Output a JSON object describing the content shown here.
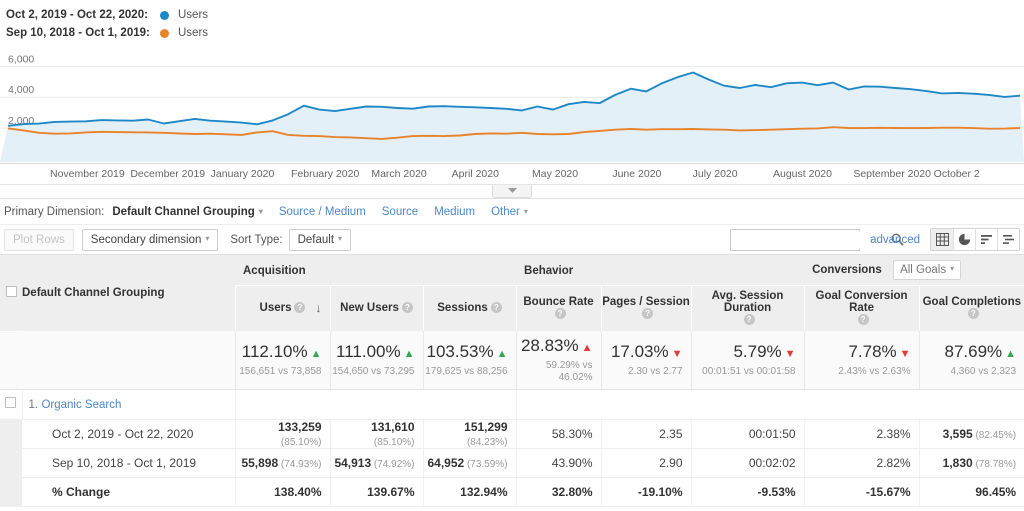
{
  "legend": {
    "rows": [
      {
        "label": "Oct 2, 2019 - Oct 22, 2020:",
        "series": "Users",
        "color": "#1E88C7"
      },
      {
        "label": "Sep 10, 2018 - Oct 1, 2019:",
        "series": "Users",
        "color": "#E8832A"
      }
    ]
  },
  "chart_data": {
    "type": "line",
    "title": "",
    "xlabel": "",
    "ylabel": "Users",
    "ylim": [
      0,
      6800
    ],
    "yticks": [
      "6,000",
      "4,000",
      "2,000"
    ],
    "ytick_values": [
      6000,
      4000,
      2000
    ],
    "grid": true,
    "legend_position": "top-left",
    "categories": [
      "November 2019",
      "December 2019",
      "January 2020",
      "February 2020",
      "March 2020",
      "April 2020",
      "May 2020",
      "June 2020",
      "July 2020",
      "August 2020",
      "September 2020",
      "October 2"
    ],
    "series": [
      {
        "name": "Users",
        "period": "Oct 2, 2019 - Oct 22, 2020",
        "color": "#1E88C7",
        "values": [
          2150,
          2260,
          2290,
          2400,
          2420,
          2440,
          2520,
          2500,
          2480,
          2560,
          2300,
          2450,
          2600,
          2480,
          2420,
          2360,
          2250,
          2500,
          2900,
          3450,
          3200,
          3100,
          3250,
          3400,
          3380,
          3300,
          3260,
          3400,
          3420,
          3380,
          3350,
          3300,
          3250,
          3150,
          3400,
          3200,
          3550,
          3700,
          3620,
          4150,
          4550,
          4380,
          4900,
          5300,
          5600,
          5150,
          4750,
          4600,
          4800,
          4650,
          4900,
          4950,
          4780,
          4950,
          4500,
          4700,
          4680,
          4600,
          4520,
          4400,
          4250,
          4280,
          4230,
          4150,
          4020,
          4100
        ]
      },
      {
        "name": "Users",
        "period": "Sep 10, 2018 - Oct 1, 2019",
        "color": "#E8832A",
        "values": [
          1980,
          1850,
          1700,
          1640,
          1660,
          1720,
          1760,
          1740,
          1730,
          1720,
          1700,
          1650,
          1620,
          1640,
          1600,
          1560,
          1720,
          1800,
          1560,
          1500,
          1480,
          1420,
          1400,
          1350,
          1300,
          1380,
          1480,
          1500,
          1480,
          1520,
          1620,
          1660,
          1640,
          1700,
          1620,
          1600,
          1620,
          1740,
          1820,
          1900,
          1950,
          1900,
          1930,
          1930,
          1940,
          1920,
          1900,
          1850,
          1870,
          1900,
          1930,
          1960,
          1980,
          2060,
          2010,
          2000,
          2020,
          2010,
          2000,
          2010,
          2030,
          2030,
          2000,
          1960,
          1970,
          2010
        ]
      }
    ]
  },
  "primary_dimension": {
    "label": "Primary Dimension:",
    "active": "Default Channel Grouping",
    "links": [
      "Source / Medium",
      "Source",
      "Medium"
    ],
    "other": "Other"
  },
  "toolbar": {
    "plot_rows": "Plot Rows",
    "secondary_dimension": "Secondary dimension",
    "sort_type_label": "Sort Type:",
    "sort_type_value": "Default",
    "search_value": "",
    "search_placeholder": "",
    "advanced": "advanced",
    "view_icons": [
      "table-view-icon",
      "pie-view-icon",
      "bar-view-icon",
      "pivot-view-icon"
    ]
  },
  "table": {
    "dimension_header": "Default Channel Grouping",
    "groups": [
      {
        "name": "Acquisition"
      },
      {
        "name": "Behavior"
      },
      {
        "name": "Conversions",
        "selector": "All Goals"
      }
    ],
    "columns": [
      "Users",
      "New Users",
      "Sessions",
      "Bounce Rate",
      "Pages / Session",
      "Avg. Session Duration",
      "Goal Conversion Rate",
      "Goal Completions"
    ],
    "sorted_column": "Users",
    "sort_direction": "desc",
    "summary": [
      {
        "value": "112.10%",
        "dir": "up",
        "tone": "good",
        "sub": "156,651 vs 73,858"
      },
      {
        "value": "111.00%",
        "dir": "up",
        "tone": "good",
        "sub": "154,650 vs 73,295"
      },
      {
        "value": "103.53%",
        "dir": "up",
        "tone": "good",
        "sub": "179,625 vs 88,256"
      },
      {
        "value": "28.83%",
        "dir": "up",
        "tone": "bad",
        "sub": "59.29% vs 46.02%"
      },
      {
        "value": "17.03%",
        "dir": "down",
        "tone": "bad",
        "sub": "2.30 vs 2.77"
      },
      {
        "value": "5.79%",
        "dir": "down",
        "tone": "bad",
        "sub": "00:01:51 vs 00:01:58"
      },
      {
        "value": "7.78%",
        "dir": "down",
        "tone": "bad",
        "sub": "2.43% vs 2.63%"
      },
      {
        "value": "87.69%",
        "dir": "up",
        "tone": "good",
        "sub": "4,360 vs 2,323"
      }
    ],
    "rows": [
      {
        "index": "1.",
        "name": "Organic Search",
        "periods": [
          {
            "label": "Oct 2, 2019 - Oct 22, 2020",
            "cells": [
              {
                "v": "133,259",
                "p": "(85.10%)"
              },
              {
                "v": "131,610",
                "p": "(85.10%)"
              },
              {
                "v": "151,299",
                "p": "(84.23%)"
              },
              {
                "v": "58.30%",
                "p": ""
              },
              {
                "v": "2.35",
                "p": ""
              },
              {
                "v": "00:01:50",
                "p": ""
              },
              {
                "v": "2.38%",
                "p": ""
              },
              {
                "v": "3,595",
                "p": "(82.45%)"
              }
            ]
          },
          {
            "label": "Sep 10, 2018 - Oct 1, 2019",
            "cells": [
              {
                "v": "55,898",
                "p": "(74.93%)"
              },
              {
                "v": "54,913",
                "p": "(74.92%)"
              },
              {
                "v": "64,952",
                "p": "(73.59%)"
              },
              {
                "v": "43.90%",
                "p": ""
              },
              {
                "v": "2.90",
                "p": ""
              },
              {
                "v": "00:02:02",
                "p": ""
              },
              {
                "v": "2.82%",
                "p": ""
              },
              {
                "v": "1,830",
                "p": "(78.78%)"
              }
            ]
          },
          {
            "label": "% Change",
            "change": true,
            "cells": [
              {
                "v": "138.40%",
                "p": ""
              },
              {
                "v": "139.67%",
                "p": ""
              },
              {
                "v": "132.94%",
                "p": ""
              },
              {
                "v": "32.80%",
                "p": ""
              },
              {
                "v": "-19.10%",
                "p": ""
              },
              {
                "v": "-9.53%",
                "p": ""
              },
              {
                "v": "-15.67%",
                "p": ""
              },
              {
                "v": "96.45%",
                "p": ""
              }
            ]
          }
        ]
      }
    ]
  }
}
